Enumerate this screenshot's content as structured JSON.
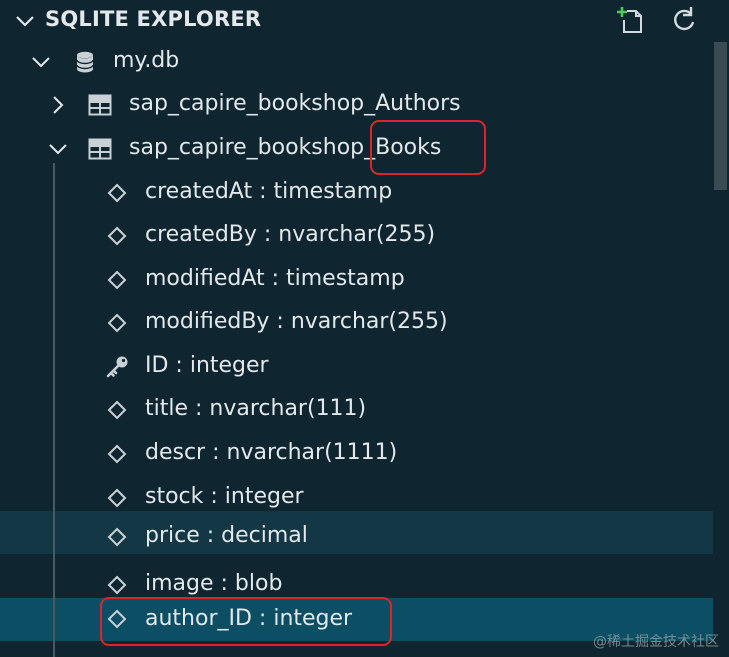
{
  "panel": {
    "title": "SQLITE EXPLORER",
    "actions": [
      {
        "name": "new-query-icon"
      },
      {
        "name": "refresh-icon"
      }
    ]
  },
  "tree": {
    "database": {
      "label": "my.db",
      "icon": "database-icon",
      "expanded": true
    },
    "tables": [
      {
        "label": "sap_capire_bookshop_Authors",
        "icon": "table-icon",
        "expanded": false
      },
      {
        "label": "sap_capire_bookshop_Books",
        "icon": "table-icon",
        "expanded": true,
        "columns": [
          {
            "label": "createdAt : timestamp",
            "icon": "field-icon"
          },
          {
            "label": "createdBy : nvarchar(255)",
            "icon": "field-icon"
          },
          {
            "label": "modifiedAt : timestamp",
            "icon": "field-icon"
          },
          {
            "label": "modifiedBy : nvarchar(255)",
            "icon": "field-icon"
          },
          {
            "label": "ID : integer",
            "icon": "key-icon"
          },
          {
            "label": "title : nvarchar(111)",
            "icon": "field-icon"
          },
          {
            "label": "descr : nvarchar(1111)",
            "icon": "field-icon"
          },
          {
            "label": "stock : integer",
            "icon": "field-icon"
          },
          {
            "label": "price : decimal",
            "icon": "field-icon",
            "state": "hover"
          },
          {
            "label": "image : blob",
            "icon": "field-icon"
          },
          {
            "label": "author_ID : integer",
            "icon": "field-icon",
            "state": "selected"
          }
        ]
      }
    ]
  },
  "colors": {
    "background": "#0f252f",
    "hover": "#133744",
    "selected": "#0c4e63",
    "annotation": "#e0232a"
  },
  "watermark": "@稀土掘金技术社区"
}
